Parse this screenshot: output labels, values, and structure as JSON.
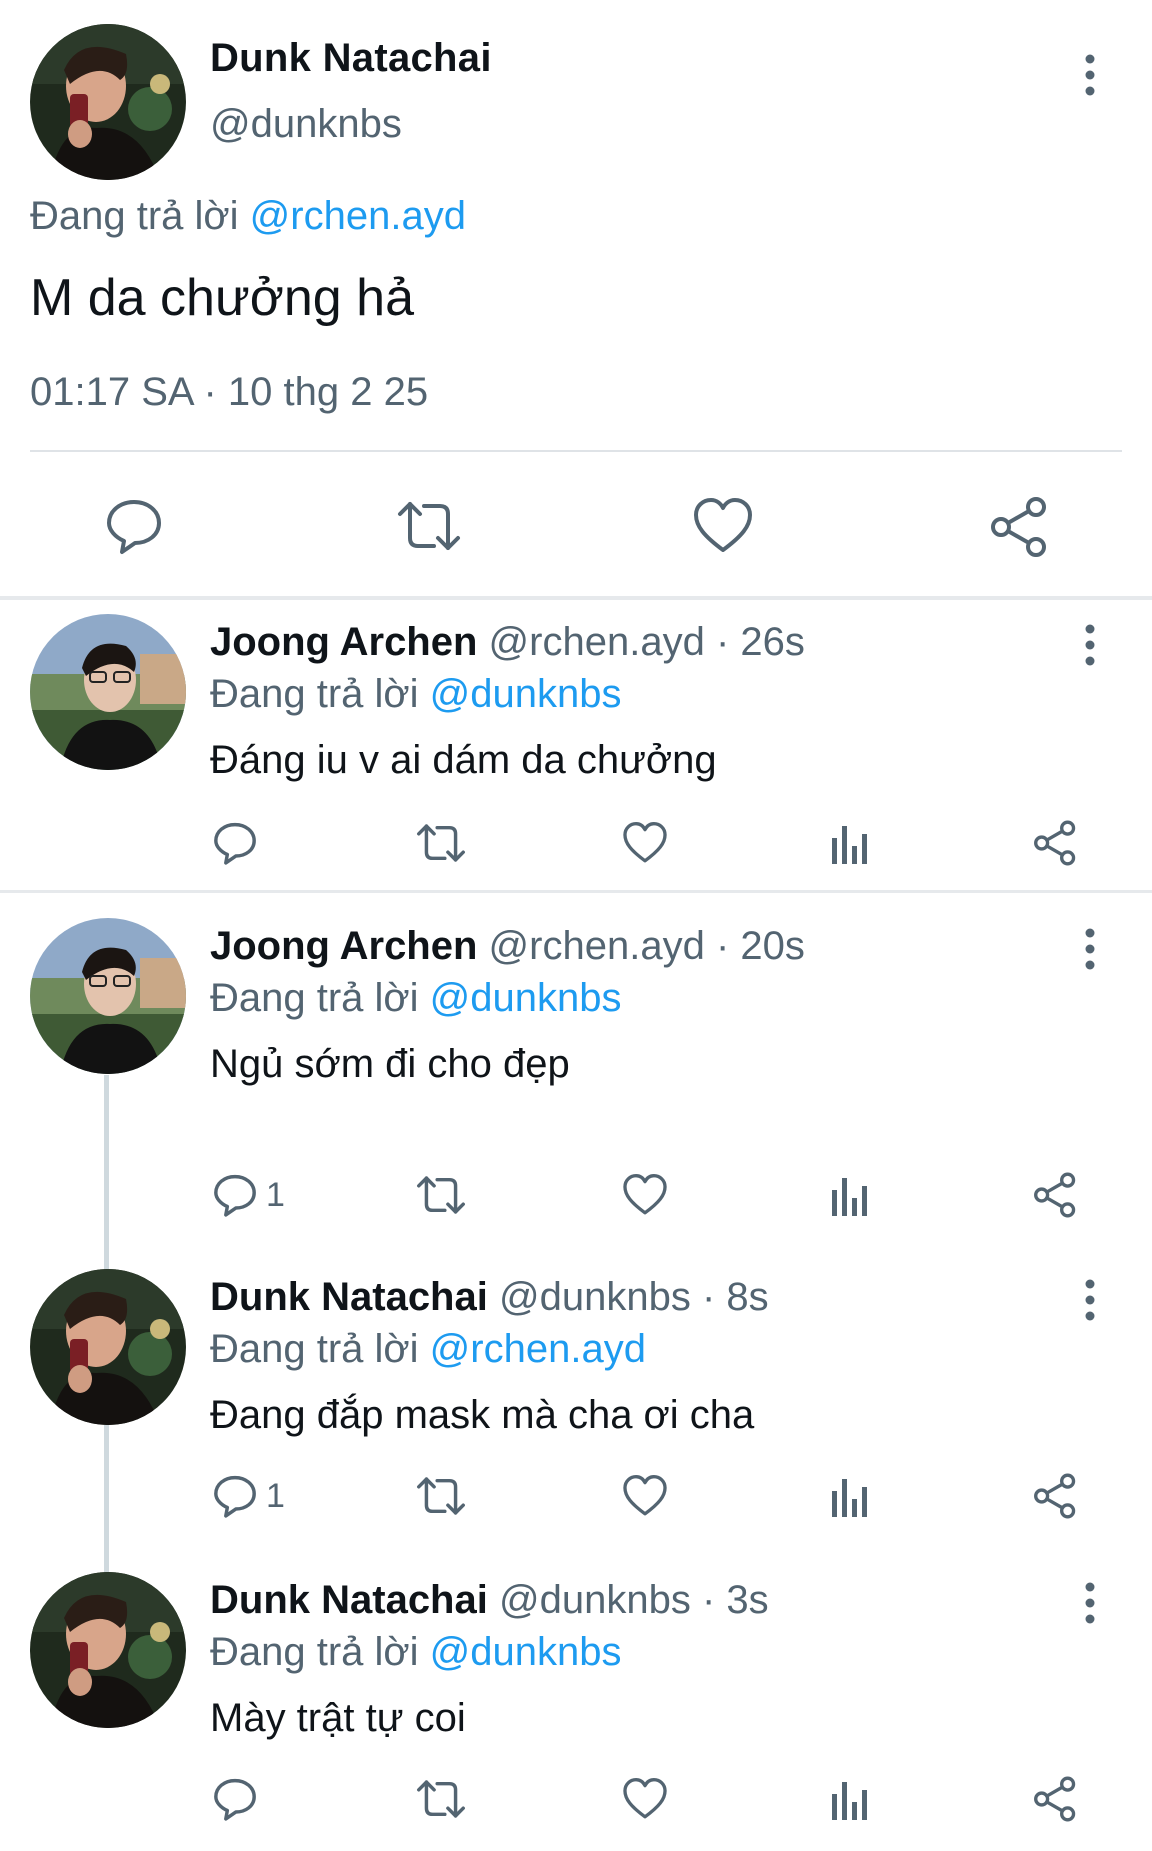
{
  "main_tweet": {
    "name": "Dunk Natachai",
    "handle": "@dunknbs",
    "replying_prefix": "Đang trả lời",
    "replying_to": "@rchen.ayd",
    "text": "M da chưởng hả",
    "timestamp": "01:17 SA · 10 thg 2 25",
    "actions": [
      "reply-icon",
      "retweet-icon",
      "like-icon",
      "share-icon"
    ]
  },
  "replies": [
    {
      "name": "Joong Archen",
      "handle": "@rchen.ayd",
      "time": "· 26s",
      "replying_prefix": "Đang trả lời",
      "replying_to": "@dunknbs",
      "text": "Đáng iu v ai dám da chưởng",
      "reply_count": ""
    },
    {
      "name": "Joong Archen",
      "handle": "@rchen.ayd",
      "time": "· 20s",
      "replying_prefix": "Đang trả lời",
      "replying_to": "@dunknbs",
      "text": "Ngủ sớm đi cho đẹp",
      "reply_count": "1"
    },
    {
      "name": "Dunk Natachai",
      "handle": "@dunknbs",
      "time": "· 8s",
      "replying_prefix": "Đang trả lời",
      "replying_to": "@rchen.ayd",
      "text": "Đang đắp mask mà cha ơi cha",
      "reply_count": "1"
    },
    {
      "name": "Dunk Natachai",
      "handle": "@dunknbs",
      "time": "· 3s",
      "replying_prefix": "Đang trả lời",
      "replying_to": "@dunknbs",
      "text": "Mày trật tự coi",
      "reply_count": ""
    }
  ],
  "colors": {
    "text": "#0f1419",
    "secondary": "#536471",
    "link": "#1d9bf0",
    "divider": "#e6e9ec",
    "thread_line": "#cfd9de"
  }
}
